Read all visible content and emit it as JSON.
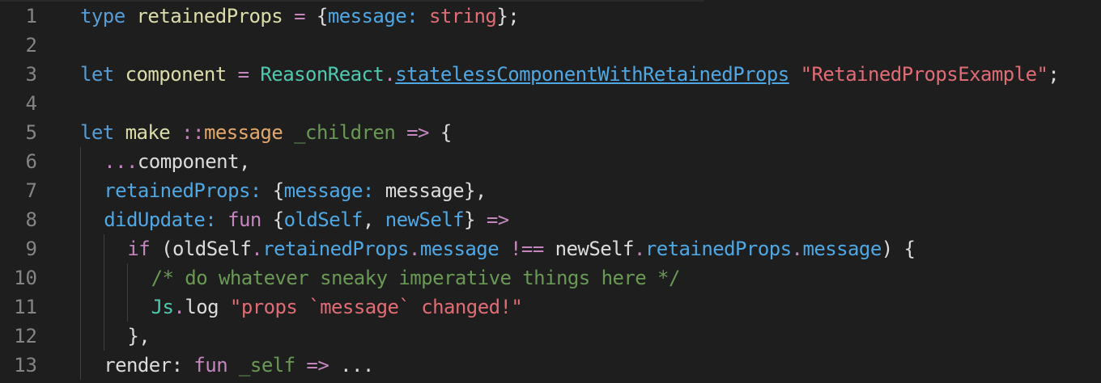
{
  "editor": {
    "line_numbers": [
      "1",
      "2",
      "3",
      "4",
      "5",
      "6",
      "7",
      "8",
      "9",
      "10",
      "11",
      "12",
      "13"
    ],
    "lines": [
      {
        "tokens": [
          {
            "t": "type",
            "c": "kw"
          },
          {
            "t": " ",
            "c": "pl"
          },
          {
            "t": "retainedProps",
            "c": "ty"
          },
          {
            "t": " = ",
            "c": "opr"
          },
          {
            "t": "{",
            "c": "pl"
          },
          {
            "t": "message",
            "c": "prop"
          },
          {
            "t": ": ",
            "c": "prop"
          },
          {
            "t": "string",
            "c": "ty2"
          },
          {
            "t": "};",
            "c": "pl"
          }
        ]
      },
      {
        "tokens": []
      },
      {
        "tokens": [
          {
            "t": "let",
            "c": "kw"
          },
          {
            "t": " ",
            "c": "pl"
          },
          {
            "t": "component",
            "c": "ty"
          },
          {
            "t": " = ",
            "c": "opr"
          },
          {
            "t": "ReasonReact",
            "c": "mod"
          },
          {
            "t": ".",
            "c": "opr"
          },
          {
            "t": "statelessComponentWithRetainedProps",
            "c": "link"
          },
          {
            "t": " ",
            "c": "pl"
          },
          {
            "t": "\"RetainedPropsExample\"",
            "c": "str"
          },
          {
            "t": ";",
            "c": "pl"
          }
        ]
      },
      {
        "tokens": []
      },
      {
        "tokens": [
          {
            "t": "let",
            "c": "kw"
          },
          {
            "t": " ",
            "c": "pl"
          },
          {
            "t": "make",
            "c": "ty"
          },
          {
            "t": " ",
            "c": "pl"
          },
          {
            "t": "::",
            "c": "opr"
          },
          {
            "t": "message",
            "c": "arg"
          },
          {
            "t": " ",
            "c": "pl"
          },
          {
            "t": "_children",
            "c": "arg2"
          },
          {
            "t": " ",
            "c": "pl"
          },
          {
            "t": "=>",
            "c": "opr"
          },
          {
            "t": " {",
            "c": "pl"
          }
        ]
      },
      {
        "tokens": [
          {
            "t": "...",
            "c": "opr"
          },
          {
            "t": "component,",
            "c": "pl"
          }
        ]
      },
      {
        "tokens": [
          {
            "t": "retainedProps",
            "c": "prop"
          },
          {
            "t": ": ",
            "c": "prop"
          },
          {
            "t": "{",
            "c": "pl"
          },
          {
            "t": "message",
            "c": "prop"
          },
          {
            "t": ": ",
            "c": "prop"
          },
          {
            "t": "message},",
            "c": "pl"
          }
        ]
      },
      {
        "tokens": [
          {
            "t": "didUpdate",
            "c": "prop"
          },
          {
            "t": ": ",
            "c": "prop"
          },
          {
            "t": "fun",
            "c": "kw2"
          },
          {
            "t": " {",
            "c": "pl"
          },
          {
            "t": "oldSelf",
            "c": "prop"
          },
          {
            "t": ", ",
            "c": "pl"
          },
          {
            "t": "newSelf",
            "c": "prop"
          },
          {
            "t": "} ",
            "c": "pl"
          },
          {
            "t": "=>",
            "c": "opr"
          }
        ]
      },
      {
        "tokens": [
          {
            "t": "if",
            "c": "kw2"
          },
          {
            "t": " (oldSelf",
            "c": "pl"
          },
          {
            "t": ".",
            "c": "opr"
          },
          {
            "t": "retainedProps",
            "c": "prop"
          },
          {
            "t": ".",
            "c": "opr"
          },
          {
            "t": "message",
            "c": "prop"
          },
          {
            "t": " ",
            "c": "pl"
          },
          {
            "t": "!==",
            "c": "opr"
          },
          {
            "t": " newSelf",
            "c": "pl"
          },
          {
            "t": ".",
            "c": "opr"
          },
          {
            "t": "retainedProps",
            "c": "prop"
          },
          {
            "t": ".",
            "c": "opr"
          },
          {
            "t": "message",
            "c": "prop"
          },
          {
            "t": ") {",
            "c": "pl"
          }
        ]
      },
      {
        "tokens": [
          {
            "t": "/* do whatever sneaky imperative things here */",
            "c": "cm"
          }
        ]
      },
      {
        "tokens": [
          {
            "t": "Js",
            "c": "mod"
          },
          {
            "t": ".",
            "c": "opr"
          },
          {
            "t": "log",
            "c": "pl"
          },
          {
            "t": " ",
            "c": "pl"
          },
          {
            "t": "\"props `message` changed!\"",
            "c": "str"
          }
        ]
      },
      {
        "tokens": [
          {
            "t": "},",
            "c": "pl"
          }
        ]
      },
      {
        "tokens": [
          {
            "t": "render",
            "c": "pl"
          },
          {
            "t": ": ",
            "c": "pl"
          },
          {
            "t": "fun",
            "c": "kw2"
          },
          {
            "t": " ",
            "c": "pl"
          },
          {
            "t": "_self",
            "c": "arg2"
          },
          {
            "t": " ",
            "c": "pl"
          },
          {
            "t": "=>",
            "c": "opr"
          },
          {
            "t": " ...",
            "c": "pl"
          }
        ]
      }
    ],
    "indents": [
      0,
      0,
      0,
      0,
      0,
      1,
      1,
      1,
      2,
      3,
      3,
      2,
      1
    ]
  },
  "colors": {
    "background": "#1e1e1e",
    "line_number": "#858585",
    "keyword": "#569cd6",
    "control_keyword": "#c586c0",
    "string": "#e06c75",
    "comment": "#6a9955",
    "module": "#4ec9b0",
    "property": "#4fa7e4"
  }
}
